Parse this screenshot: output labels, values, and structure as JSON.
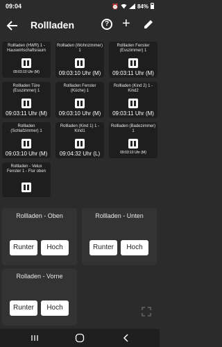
{
  "status": {
    "time": "09:04",
    "battery": "84%"
  },
  "app": {
    "title": "Rollladen"
  },
  "tiles": [
    {
      "name": "Rollladen (HWR) 1 - Hauswirtschaftsraum",
      "time": "09:03:10 Uhr (M)",
      "size": "small"
    },
    {
      "name": "Rollladen (Wohnzimmer) 1",
      "time": "09:03:10 Uhr (M)",
      "size": "big"
    },
    {
      "name": "Rollladen Fenster (Esszimmer) 1",
      "time": "09:03:11 Uhr (M)",
      "size": "big"
    },
    {
      "name": "Rollladen Türe (Esszimmer) 1",
      "time": "09:03:11 Uhr (M)",
      "size": "big"
    },
    {
      "name": "Rollladen Fenster (Küche) 1",
      "time": "09:03:10 Uhr (M)",
      "size": "big"
    },
    {
      "name": "Rollladen (Kind 2) 1 - Kind2",
      "time": "09:03:11 Uhr (M)",
      "size": "big"
    },
    {
      "name": "Rollladen (Schlafzimmer) 1",
      "time": "09:03:10 Uhr (M)",
      "size": "big"
    },
    {
      "name": "Rollladen (Kind 1) 1 - Kind1",
      "time": "09:04:32 Uhr (L)",
      "size": "big"
    },
    {
      "name": "Rollladen (Badezimmer) 1",
      "time": "09:03:10 Uhr (M)",
      "size": "small"
    },
    {
      "name": "Rollladen - Velux Fenster 1 - Flur oben",
      "time": "",
      "size": "small"
    }
  ],
  "groups": [
    {
      "title": "Rollladen - Oben",
      "down": "Runter",
      "up": "Hoch"
    },
    {
      "title": "Rollladen - Unten",
      "down": "Runter",
      "up": "Hoch"
    },
    {
      "title": "Rolladen - Vorne",
      "down": "Runter",
      "up": "Hoch"
    }
  ]
}
